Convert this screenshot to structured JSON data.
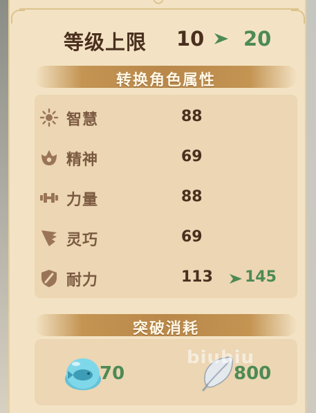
{
  "level": {
    "label": "等级上限",
    "current": "10",
    "next": "20"
  },
  "attributes_section": {
    "title": "转换角色属性",
    "items": [
      {
        "icon": "wisdom-icon",
        "name": "智慧",
        "value": "88"
      },
      {
        "icon": "spirit-icon",
        "name": "精神",
        "value": "69"
      },
      {
        "icon": "strength-icon",
        "name": "力量",
        "value": "88"
      },
      {
        "icon": "agility-icon",
        "name": "灵巧",
        "value": "69"
      },
      {
        "icon": "endurance-icon",
        "name": "耐力",
        "value": "113",
        "new_value": "145"
      }
    ]
  },
  "cost_section": {
    "title": "突破消耗",
    "items": [
      {
        "icon": "fish-jelly-icon",
        "amount": "70"
      },
      {
        "icon": "silver-leaf-icon",
        "amount": "800"
      }
    ]
  },
  "watermark": "biubiu",
  "colors": {
    "panel": "#f3e3c4",
    "banner": "#b9884a",
    "text_dark": "#4a2f1f",
    "text_attr": "#7a5a41",
    "increase_green": "#4e8a55"
  }
}
